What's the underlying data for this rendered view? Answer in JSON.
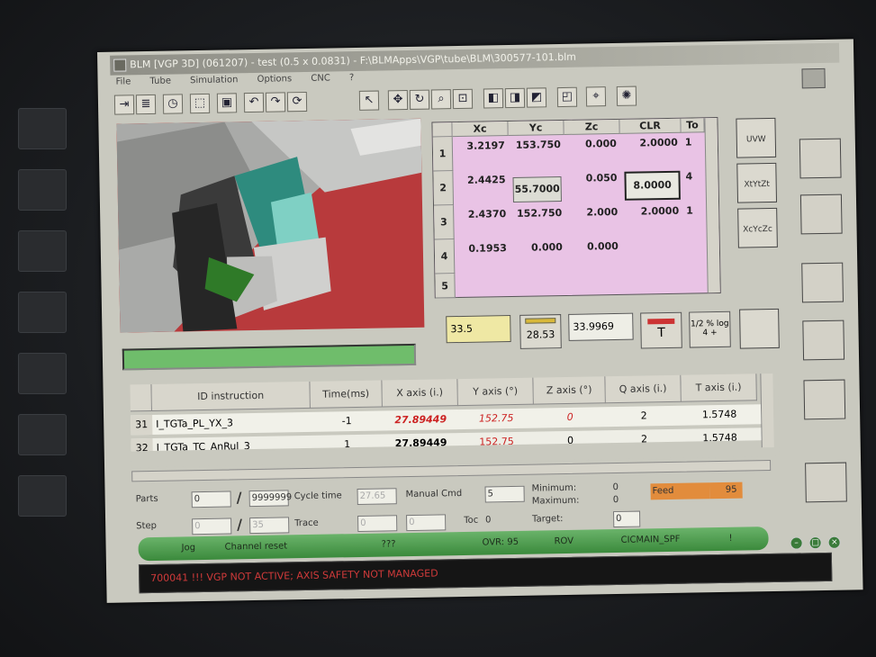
{
  "window": {
    "title": "BLM [VGP 3D] (061207) - test (0.5 x 0.0831) - F:\\BLMApps\\VGP\\tube\\BLM\\300577-101.blm",
    "close_glyph": "X"
  },
  "menu": [
    "File",
    "Tube",
    "Simulation",
    "Options",
    "CNC",
    "?"
  ],
  "coord_table": {
    "headers": [
      "Xc",
      "Yc",
      "Zc",
      "CLR",
      "To"
    ],
    "rows": [
      {
        "num": "1",
        "xc": "3.2197",
        "yc": "153.750",
        "zc": "0.000",
        "clr": "2.0000",
        "to": "1"
      },
      {
        "num": "2",
        "xc": "2.4425",
        "yc": "55.7000",
        "zc": "0.050",
        "clr": "8.0000",
        "to": "4"
      },
      {
        "num": "3",
        "xc": "2.4370",
        "yc": "152.750",
        "zc": "2.000",
        "clr": "2.0000",
        "to": "1"
      },
      {
        "num": "4",
        "xc": "0.1953",
        "yc": "0.000",
        "zc": "0.000",
        "clr": "",
        "to": ""
      },
      {
        "num": "5",
        "xc": "",
        "yc": "",
        "zc": "",
        "clr": "",
        "to": ""
      }
    ]
  },
  "fields": {
    "yellow_value": "33.5",
    "ruler_value": "28.53",
    "measure_value": "33.9969",
    "tool_t_label": "T",
    "calc_label": "1/2 % log 4 +"
  },
  "right_buttons": {
    "uvw": "UVW",
    "xtytzt": "XtYtZt",
    "xcyczc": "XcYcZc"
  },
  "instr_table": {
    "headers": [
      "ID instruction",
      "Time(ms)",
      "X axis  (i.)",
      "Y axis  (°)",
      "Z axis  (°)",
      "Q axis  (i.)",
      "T axis  (i.)"
    ],
    "rows": [
      {
        "num": "31",
        "id": "I_TGTa_PL_YX_3",
        "time": "-1",
        "x": "27.89449",
        "y": "152.75",
        "z": "0",
        "q": "2",
        "t": "1.5748"
      },
      {
        "num": "32",
        "id": "I_TGTa_TC_AnRul_3",
        "time": "1",
        "x": "27.89449",
        "y": "152.75",
        "z": "0",
        "q": "2",
        "t": "1.5748"
      }
    ]
  },
  "info": {
    "parts_label": "Parts",
    "parts_value": "0",
    "parts_max": "9999999",
    "cycle_time_label": "Cycle time",
    "cycle_time_value": "27.65",
    "manual_cmd_label": "Manual Cmd",
    "manual_cmd_value": "5",
    "minimum_label": "Minimum:",
    "minimum_value": "0",
    "maximum_label": "Maximum:",
    "maximum_value": "0",
    "feed_label": "Feed",
    "feed_value": "95",
    "step_label": "Step",
    "step_value": "0",
    "step_max": "35",
    "trace_label": "Trace",
    "trace_value": "0",
    "trace_value2": "0",
    "toc_label": "Toc",
    "toc_value": "0",
    "target_label": "Target:",
    "target_value": "0",
    "slash": "/"
  },
  "status": {
    "mode": "Jog",
    "channel": "Channel reset",
    "unknown": "???",
    "ovr": "OVR: 95",
    "rov": "ROV",
    "program": "CICMAIN_SPF",
    "marker": "!"
  },
  "alarm": "700041 !!! VGP NOT ACTIVE; AXIS SAFETY NOT MANAGED",
  "colors": {
    "table_pink": "#e9c3e5",
    "viewport_red": "#b83a3c",
    "feed_orange": "#e28c3c",
    "status_green": "#4f9e4f",
    "alarm_red": "#d03a3a"
  }
}
